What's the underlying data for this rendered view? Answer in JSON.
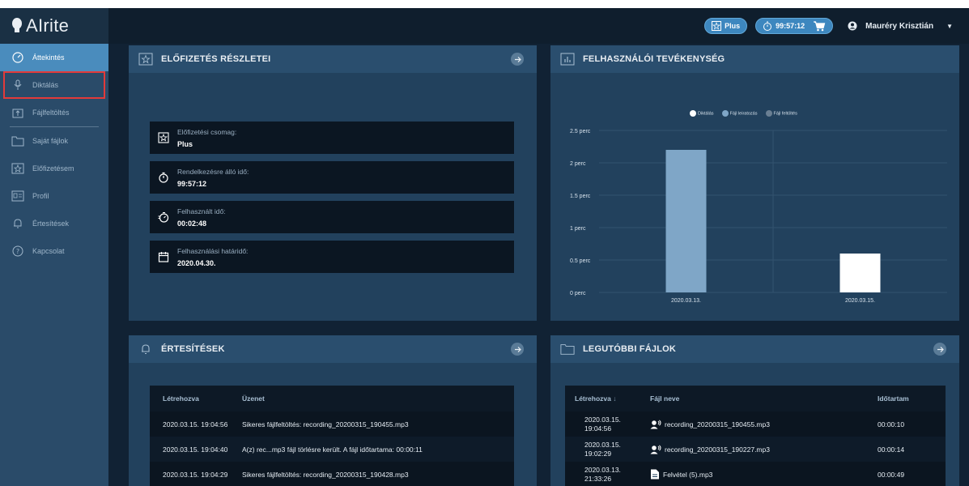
{
  "app": {
    "logo_text": "AIrite"
  },
  "sidebar": {
    "items": [
      {
        "label": "Áttekintés",
        "icon": "gauge-icon"
      },
      {
        "label": "Diktálás",
        "icon": "microphone-icon"
      },
      {
        "label": "Fájlfeltöltés",
        "icon": "upload-icon"
      },
      {
        "label": "Saját fájlok",
        "icon": "folder-icon"
      },
      {
        "label": "Előfizetésem",
        "icon": "star-icon"
      },
      {
        "label": "Profil",
        "icon": "profile-icon"
      },
      {
        "label": "Értesítések",
        "icon": "bell-icon"
      },
      {
        "label": "Kapcsolat",
        "icon": "help-icon"
      }
    ]
  },
  "topbar": {
    "plan_label": "Plus",
    "time_label": "99:57:12",
    "user_name": "Mauréry Krisztián"
  },
  "subscription": {
    "title": "ELŐFIZETÉS RÉSZLETEI",
    "rows": [
      {
        "label": "Előfizetési csomag:",
        "value": "Plus"
      },
      {
        "label": "Rendelkezésre álló idő:",
        "value": "99:57:12"
      },
      {
        "label": "Felhasznált idő:",
        "value": "00:02:48"
      },
      {
        "label": "Felhasználási határidő:",
        "value": "2020.04.30."
      }
    ]
  },
  "activity": {
    "title": "FELHASZNÁLÓI TEVÉKENYSÉG",
    "legend": [
      "Diktálás",
      "Fájl leiratozás",
      "Fájl feltöltés"
    ]
  },
  "chart_data": {
    "type": "bar",
    "categories": [
      "2020.03.13.",
      "2020.03.15."
    ],
    "series": [
      {
        "name": "Diktálás",
        "values": [
          0,
          0.6
        ],
        "color": "#ffffff"
      },
      {
        "name": "Fájl leiratozás",
        "values": [
          2.2,
          0
        ],
        "color": "#7fa6c7"
      },
      {
        "name": "Fájl feltöltés",
        "values": [
          0,
          0
        ],
        "color": "#6a7f93"
      }
    ],
    "y_ticks": [
      "0 perc",
      "0.5 perc",
      "1 perc",
      "1.5 perc",
      "2 perc",
      "2.5 perc"
    ],
    "ylim": [
      0,
      2.5
    ],
    "legend_position": "top"
  },
  "notifications": {
    "title": "ÉRTESÍTÉSEK",
    "columns": [
      "Létrehozva",
      "Üzenet"
    ],
    "rows": [
      {
        "created": "2020.03.15. 19:04:56",
        "message": "Sikeres fájlfeltöltés: recording_20200315_190455.mp3"
      },
      {
        "created": "2020.03.15. 19:04:40",
        "message": "A(z) rec...mp3 fájl törlésre került. A fájl időtartama: 00:00:11"
      },
      {
        "created": "2020.03.15. 19:04:29",
        "message": "Sikeres fájlfeltöltés: recording_20200315_190428.mp3"
      }
    ]
  },
  "recent_files": {
    "title": "LEGUTÓBBI FÁJLOK",
    "columns": [
      "Létrehozva",
      "Fájl neve",
      "Időtartam"
    ],
    "rows": [
      {
        "created_date": "2020.03.15.",
        "created_time": "19:04:56",
        "name": "recording_20200315_190455.mp3",
        "duration": "00:00:10",
        "icon": "voice-icon"
      },
      {
        "created_date": "2020.03.15.",
        "created_time": "19:02:29",
        "name": "recording_20200315_190227.mp3",
        "duration": "00:00:14",
        "icon": "voice-icon"
      },
      {
        "created_date": "2020.03.13.",
        "created_time": "21:33:26",
        "name": "Felvétel (5).mp3",
        "duration": "00:00:49",
        "icon": "file-icon"
      }
    ]
  }
}
